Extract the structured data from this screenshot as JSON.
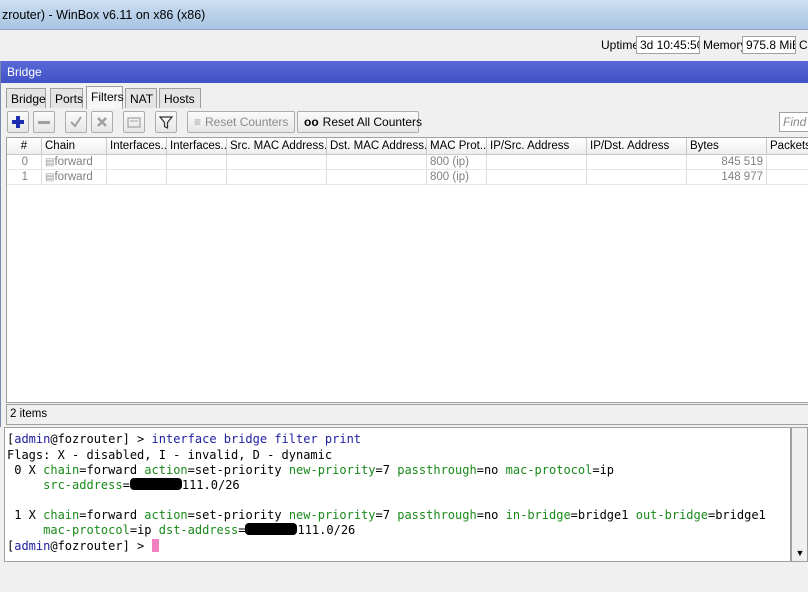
{
  "window": {
    "title": "zrouter) - WinBox v6.11 on x86 (x86)"
  },
  "status": {
    "uptime_label": "Uptime:",
    "uptime_value": "3d 10:45:50",
    "memory_label": "Memory:",
    "memory_value": "975.8 MiB",
    "cpu_label": "C"
  },
  "bridge": {
    "title": "Bridge",
    "tabs": [
      "Bridge",
      "Ports",
      "Filters",
      "NAT",
      "Hosts"
    ],
    "active_tab": "Filters",
    "toolbar": {
      "reset_counters": "Reset Counters",
      "reset_all_counters": "Reset All Counters",
      "find_placeholder": "Find",
      "icons": [
        "plus-icon",
        "minus-icon",
        "check-icon",
        "cross-icon",
        "comment-icon",
        "filter-icon"
      ]
    },
    "columns": [
      "#",
      "Chain",
      "Interfaces...",
      "Interfaces...",
      "Src. MAC Address...",
      "Dst. MAC Address...",
      "MAC Prot...",
      "IP/Src. Address",
      "IP/Dst. Address",
      "Bytes",
      "Packets"
    ],
    "rows": [
      {
        "num": "0",
        "chain": "forward",
        "mac_protocol": "800 (ip)",
        "bytes": "845 519"
      },
      {
        "num": "1",
        "chain": "forward",
        "mac_protocol": "800 (ip)",
        "bytes": "148 977"
      }
    ],
    "items_count": "2 items"
  },
  "terminal": {
    "prompt_user": "admin",
    "prompt_host": "@fozrouter",
    "prompt_tail": "] > ",
    "command": "interface bridge filter print",
    "flags_line": "Flags: X - disabled, I - invalid, D - dynamic",
    "rule0": {
      "index": " 0 X ",
      "chain": "forward",
      "action": "set-priority",
      "new_priority": "7",
      "passthrough": "no",
      "mac_protocol": "ip",
      "src_suffix": "111.0/26"
    },
    "rule1": {
      "index": " 1 X ",
      "chain": "forward",
      "action": "set-priority",
      "new_priority": "7",
      "passthrough": "no",
      "in_bridge": "bridge1",
      "out_bridge": "bridge1",
      "mac_protocol": "ip",
      "dst_suffix": "111.0/26"
    }
  }
}
